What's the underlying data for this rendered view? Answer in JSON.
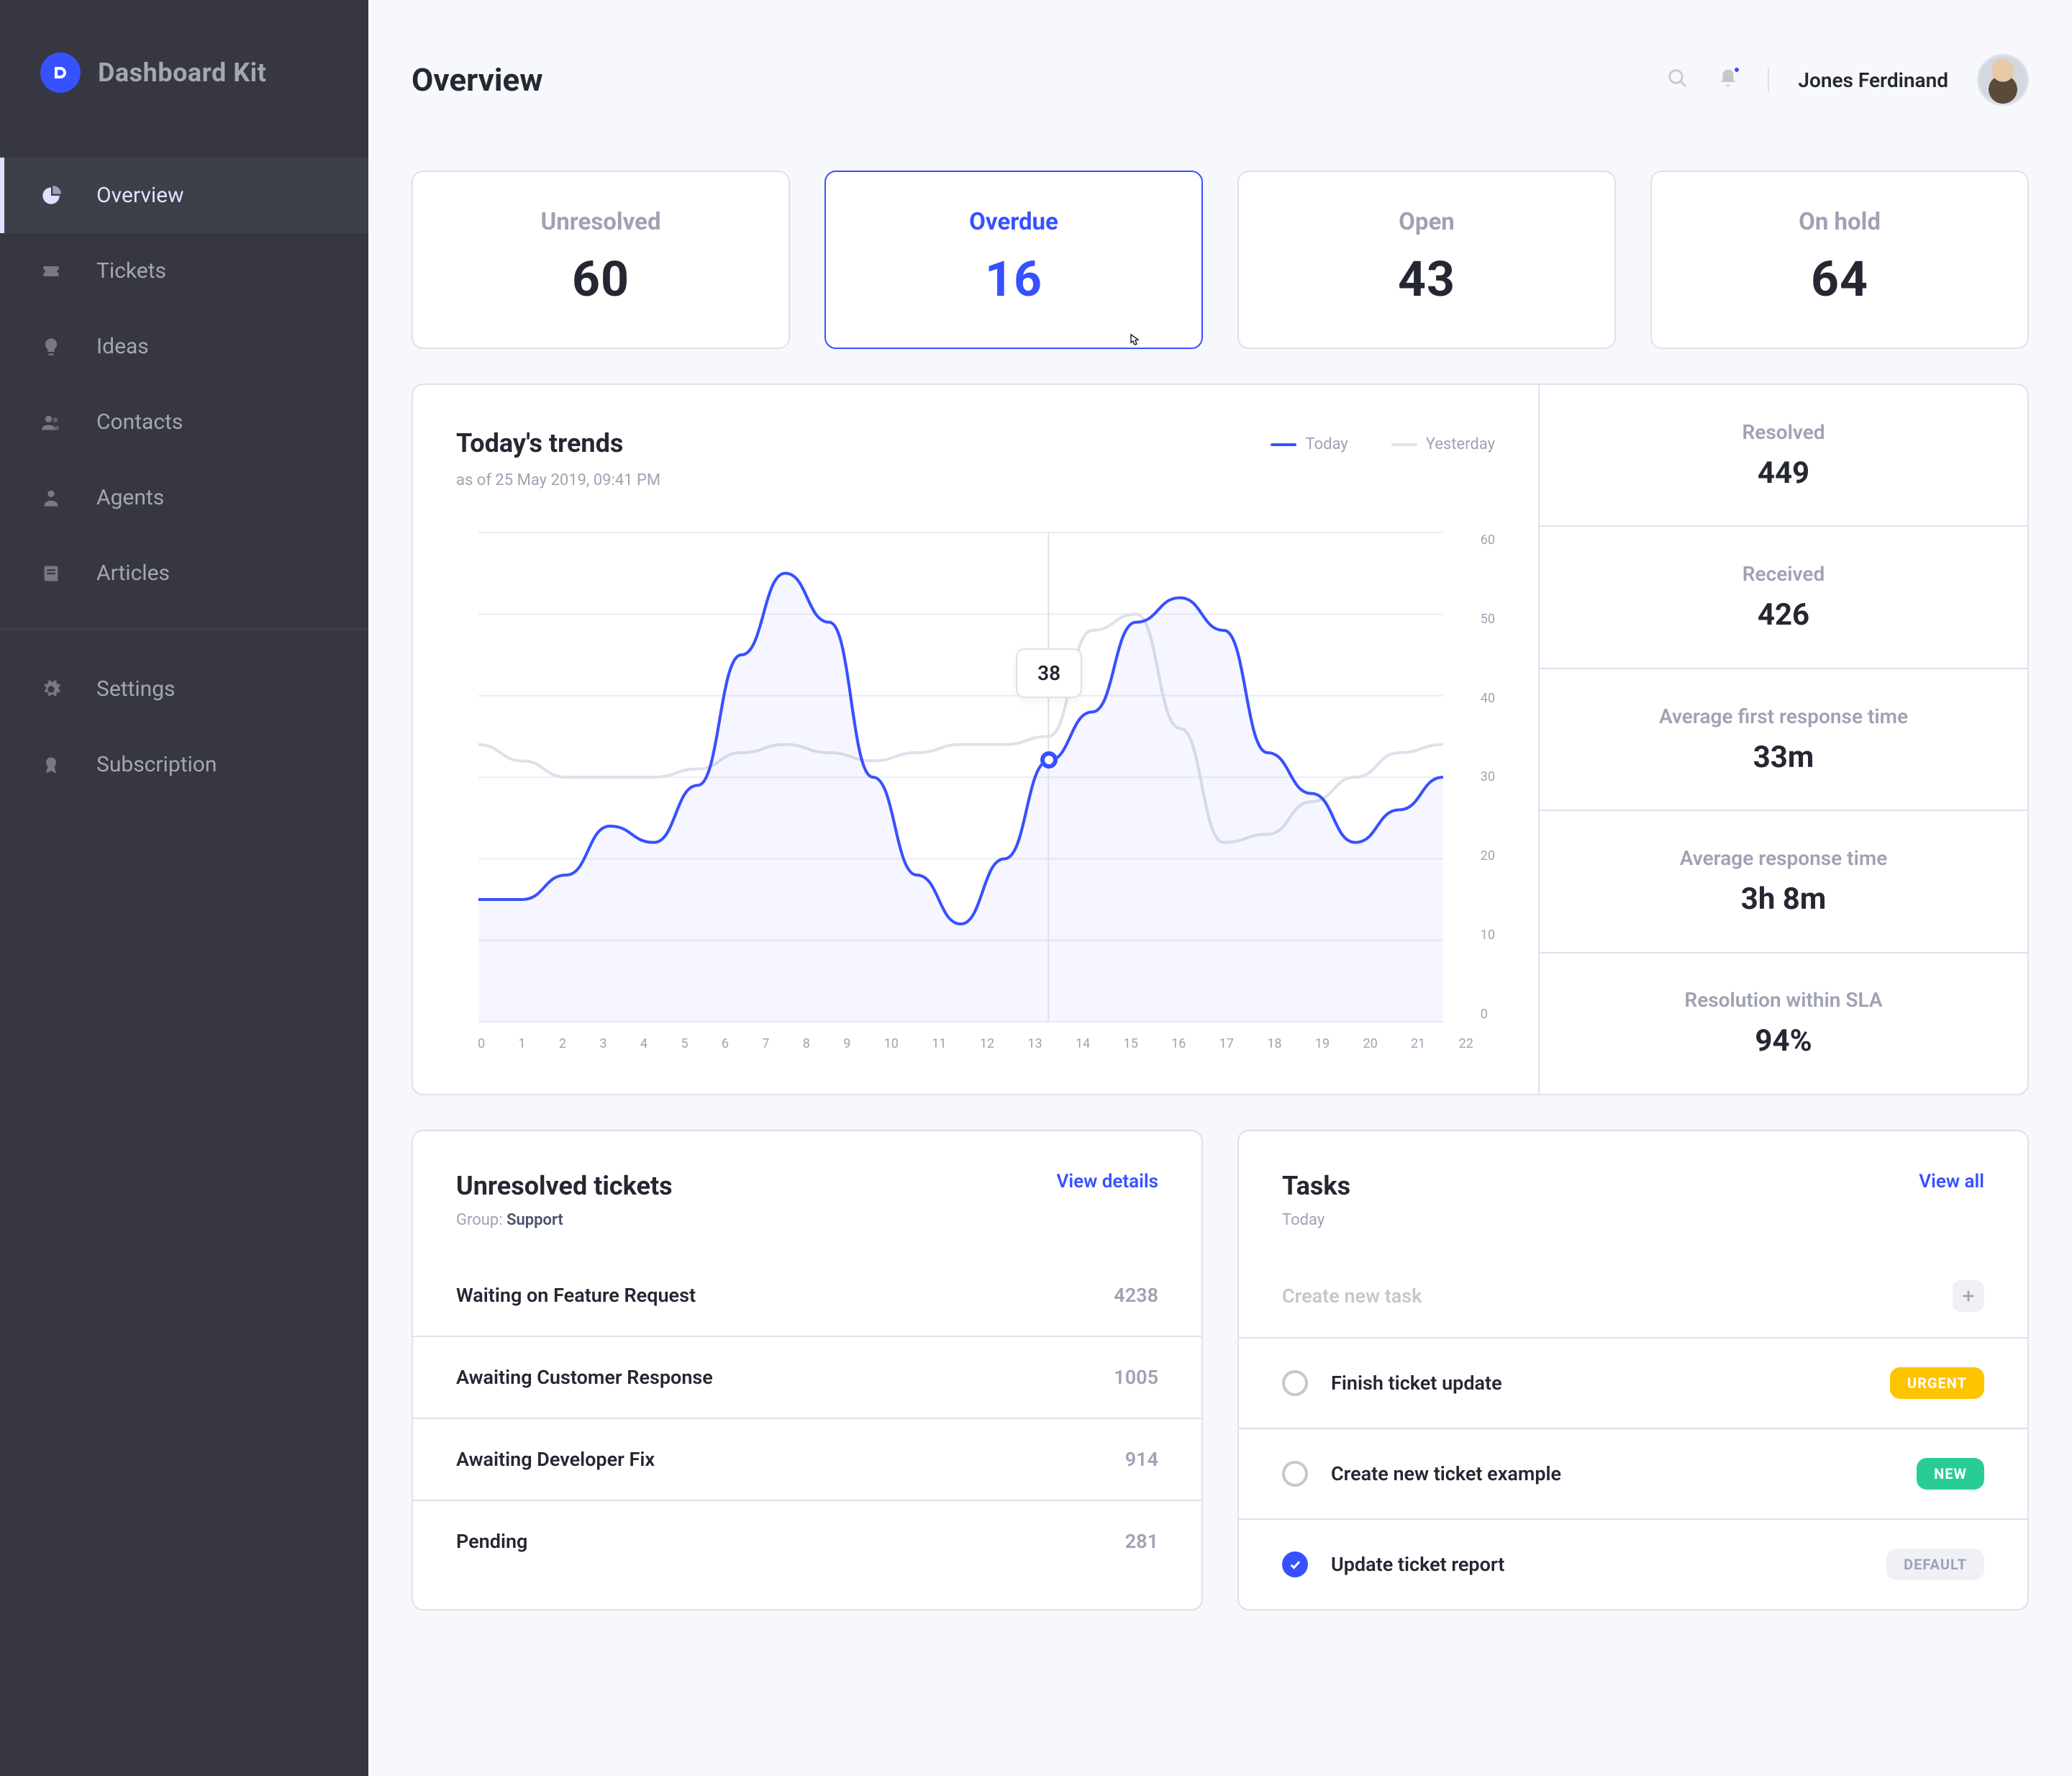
{
  "brand": {
    "name": "Dashboard Kit",
    "initial": "D"
  },
  "sidebar": {
    "items": [
      {
        "label": "Overview",
        "icon": "pie-chart-icon",
        "active": true
      },
      {
        "label": "Tickets",
        "icon": "ticket-icon",
        "active": false
      },
      {
        "label": "Ideas",
        "icon": "lightbulb-icon",
        "active": false
      },
      {
        "label": "Contacts",
        "icon": "contacts-icon",
        "active": false
      },
      {
        "label": "Agents",
        "icon": "agent-icon",
        "active": false
      },
      {
        "label": "Articles",
        "icon": "book-icon",
        "active": false
      }
    ],
    "footerItems": [
      {
        "label": "Settings",
        "icon": "gear-icon"
      },
      {
        "label": "Subscription",
        "icon": "badge-icon"
      }
    ]
  },
  "header": {
    "title": "Overview",
    "user": "Jones Ferdinand"
  },
  "statCards": [
    {
      "label": "Unresolved",
      "value": "60",
      "active": false
    },
    {
      "label": "Overdue",
      "value": "16",
      "active": true
    },
    {
      "label": "Open",
      "value": "43",
      "active": false
    },
    {
      "label": "On hold",
      "value": "64",
      "active": false
    }
  ],
  "trends": {
    "title": "Today's trends",
    "subtitle": "as of 25 May 2019, 09:41 PM",
    "legend": {
      "today": "Today",
      "yesterday": "Yesterday"
    },
    "tooltip": "38",
    "sideStats": [
      {
        "label": "Resolved",
        "value": "449"
      },
      {
        "label": "Received",
        "value": "426"
      },
      {
        "label": "Average first response time",
        "value": "33m"
      },
      {
        "label": "Average response time",
        "value": "3h 8m"
      },
      {
        "label": "Resolution within SLA",
        "value": "94%"
      }
    ]
  },
  "chart_data": {
    "type": "line",
    "xlabel": "",
    "ylabel": "",
    "ylim": [
      0,
      60
    ],
    "x": [
      0,
      1,
      2,
      3,
      4,
      5,
      6,
      7,
      8,
      9,
      10,
      11,
      12,
      13,
      14,
      15,
      16,
      17,
      18,
      19,
      20,
      21,
      22
    ],
    "yticks": [
      0,
      10,
      20,
      30,
      40,
      50,
      60
    ],
    "series": [
      {
        "name": "Today",
        "color": "#3751FF",
        "values": [
          15,
          15,
          18,
          24,
          22,
          29,
          45,
          55,
          49,
          30,
          18,
          12,
          20,
          32,
          38,
          49,
          52,
          48,
          33,
          28,
          22,
          26,
          30
        ]
      },
      {
        "name": "Yesterday",
        "color": "#DFE0EB",
        "values": [
          34,
          32,
          30,
          30,
          30,
          31,
          33,
          34,
          33,
          32,
          33,
          34,
          34,
          35,
          48,
          50,
          36,
          22,
          23,
          27,
          30,
          33,
          34
        ]
      }
    ],
    "highlight": {
      "x": 13,
      "y": 38
    }
  },
  "unresolved": {
    "title": "Unresolved tickets",
    "link": "View details",
    "groupLabel": "Group:",
    "groupValue": "Support",
    "rows": [
      {
        "label": "Waiting on Feature Request",
        "value": "4238"
      },
      {
        "label": "Awaiting Customer Response",
        "value": "1005"
      },
      {
        "label": "Awaiting Developer Fix",
        "value": "914"
      },
      {
        "label": "Pending",
        "value": "281"
      }
    ]
  },
  "tasks": {
    "title": "Tasks",
    "link": "View all",
    "subtitle": "Today",
    "placeholder": "Create new task",
    "items": [
      {
        "label": "Finish ticket update",
        "badge": "URGENT",
        "badgeClass": "urgent",
        "checked": false
      },
      {
        "label": "Create new ticket example",
        "badge": "NEW",
        "badgeClass": "new",
        "checked": false
      },
      {
        "label": "Update ticket report",
        "badge": "DEFAULT",
        "badgeClass": "default",
        "checked": true
      }
    ]
  }
}
